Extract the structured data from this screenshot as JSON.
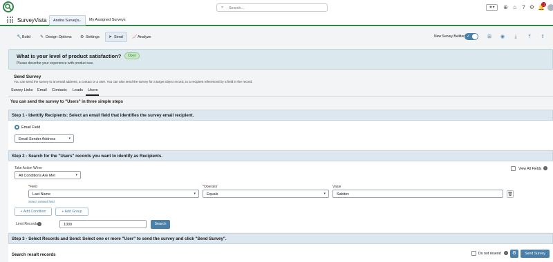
{
  "header": {
    "search_placeholder": "Search...",
    "notification_count": "12"
  },
  "nav": {
    "app_name": "SurveyVista",
    "active_tab": "Andira Surveys",
    "tab_assigned": "My Assigned Surveys"
  },
  "toolbar": {
    "build": "Build",
    "design_options": "Design Options",
    "settings": "Settings",
    "send": "Send",
    "analyze": "Analyze",
    "builder_toggle_label": "New Survey Builder"
  },
  "survey": {
    "title": "What is your level of product satisfaction?",
    "status": "Open",
    "subtitle": "Please describe your experience with product use."
  },
  "send_survey": {
    "title": "Send Survey",
    "description": "You can send the survey to an email address, a contact or a user. You can also send the survey for a target object record, to a recipient referenced by a field in the record.",
    "tabs": [
      "Survey Links",
      "Email",
      "Contacts",
      "Leads",
      "Users"
    ],
    "intro": "You can send the survey to \"Users\" in three simple steps"
  },
  "step1": {
    "title": "Step 1 - Identify Recipients: Select an email field that identifies the survey email recipient.",
    "radio_label": "Email Field",
    "email_field_value": "Email Sender Address"
  },
  "step2": {
    "title": "Step 2 - Search for the \"Users\" records you want to identify as Recipients.",
    "take_action_label": "Take Action When",
    "take_action_value": "All Conditions Are Met",
    "view_all_fields": "View All Fields",
    "field_label": "Field",
    "operator_label": "Operator",
    "value_label": "Value",
    "field_value": "Last Name",
    "operator_value": "Equals",
    "value_value": "Sabitov",
    "related_link": "Select related field",
    "add_condition": "+ Add Condition",
    "add_group": "+ Add Group",
    "limit_label": "Limit Records",
    "limit_value": "1000",
    "search_button": "Search"
  },
  "step3": {
    "title": "Step 3 - Select Records and Send: Select one or more \"User\" to send the survey and click \"Send Survey\".",
    "results_title": "Search result records",
    "do_not_resend": "Do not resend",
    "send_button": "Send Survey"
  },
  "colors": {
    "brand_green": "#2e844a",
    "accent_blue": "#4a7fa7",
    "step_bar": "#dce7ef"
  }
}
